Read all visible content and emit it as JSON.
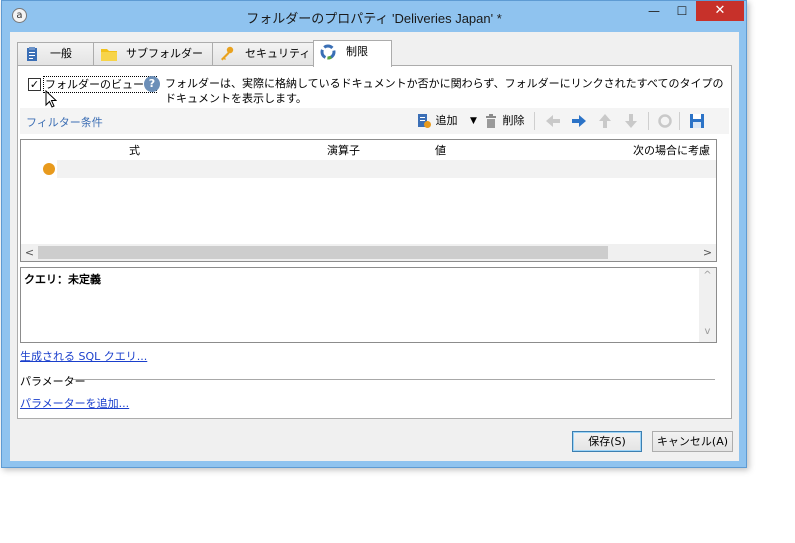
{
  "window": {
    "title": "フォルダーのプロパティ 'Deliveries Japan' *",
    "minimize": "—",
    "maximize": "☐",
    "close": "✕"
  },
  "tabs": [
    {
      "label": "一般",
      "icon": "clipboard-icon"
    },
    {
      "label": "サブフォルダー",
      "icon": "folder-icon"
    },
    {
      "label": "セキュリティ",
      "icon": "key-icon"
    },
    {
      "label": "制限",
      "icon": "restriction-icon",
      "active": true
    }
  ],
  "restriction": {
    "checkbox_label": "フォルダーのビュー化",
    "checked": true,
    "description": "フォルダーは、実際に格納しているドキュメントか否かに関わらず、フォルダーにリンクされたすべてのタイプのドキュメントを表示します。",
    "filter_label": "フィルター条件",
    "toolbar": {
      "add": "追加",
      "delete": "削除"
    },
    "grid": {
      "columns": [
        "式",
        "演算子",
        "値",
        "次の場合に考慮"
      ]
    },
    "query_text": "クエリ：未定義",
    "sql_link": "生成される SQL クエリ...",
    "params_heading": "パラメーター",
    "add_param_link": "パラメーターを追加..."
  },
  "buttons": {
    "save": "保存(S)",
    "cancel": "キャンセル(A)"
  },
  "colors": {
    "title_bar": "#8fc3ef",
    "close_button": "#c7312a",
    "link": "#1a3fcc",
    "accent": "#3c6eb4"
  }
}
